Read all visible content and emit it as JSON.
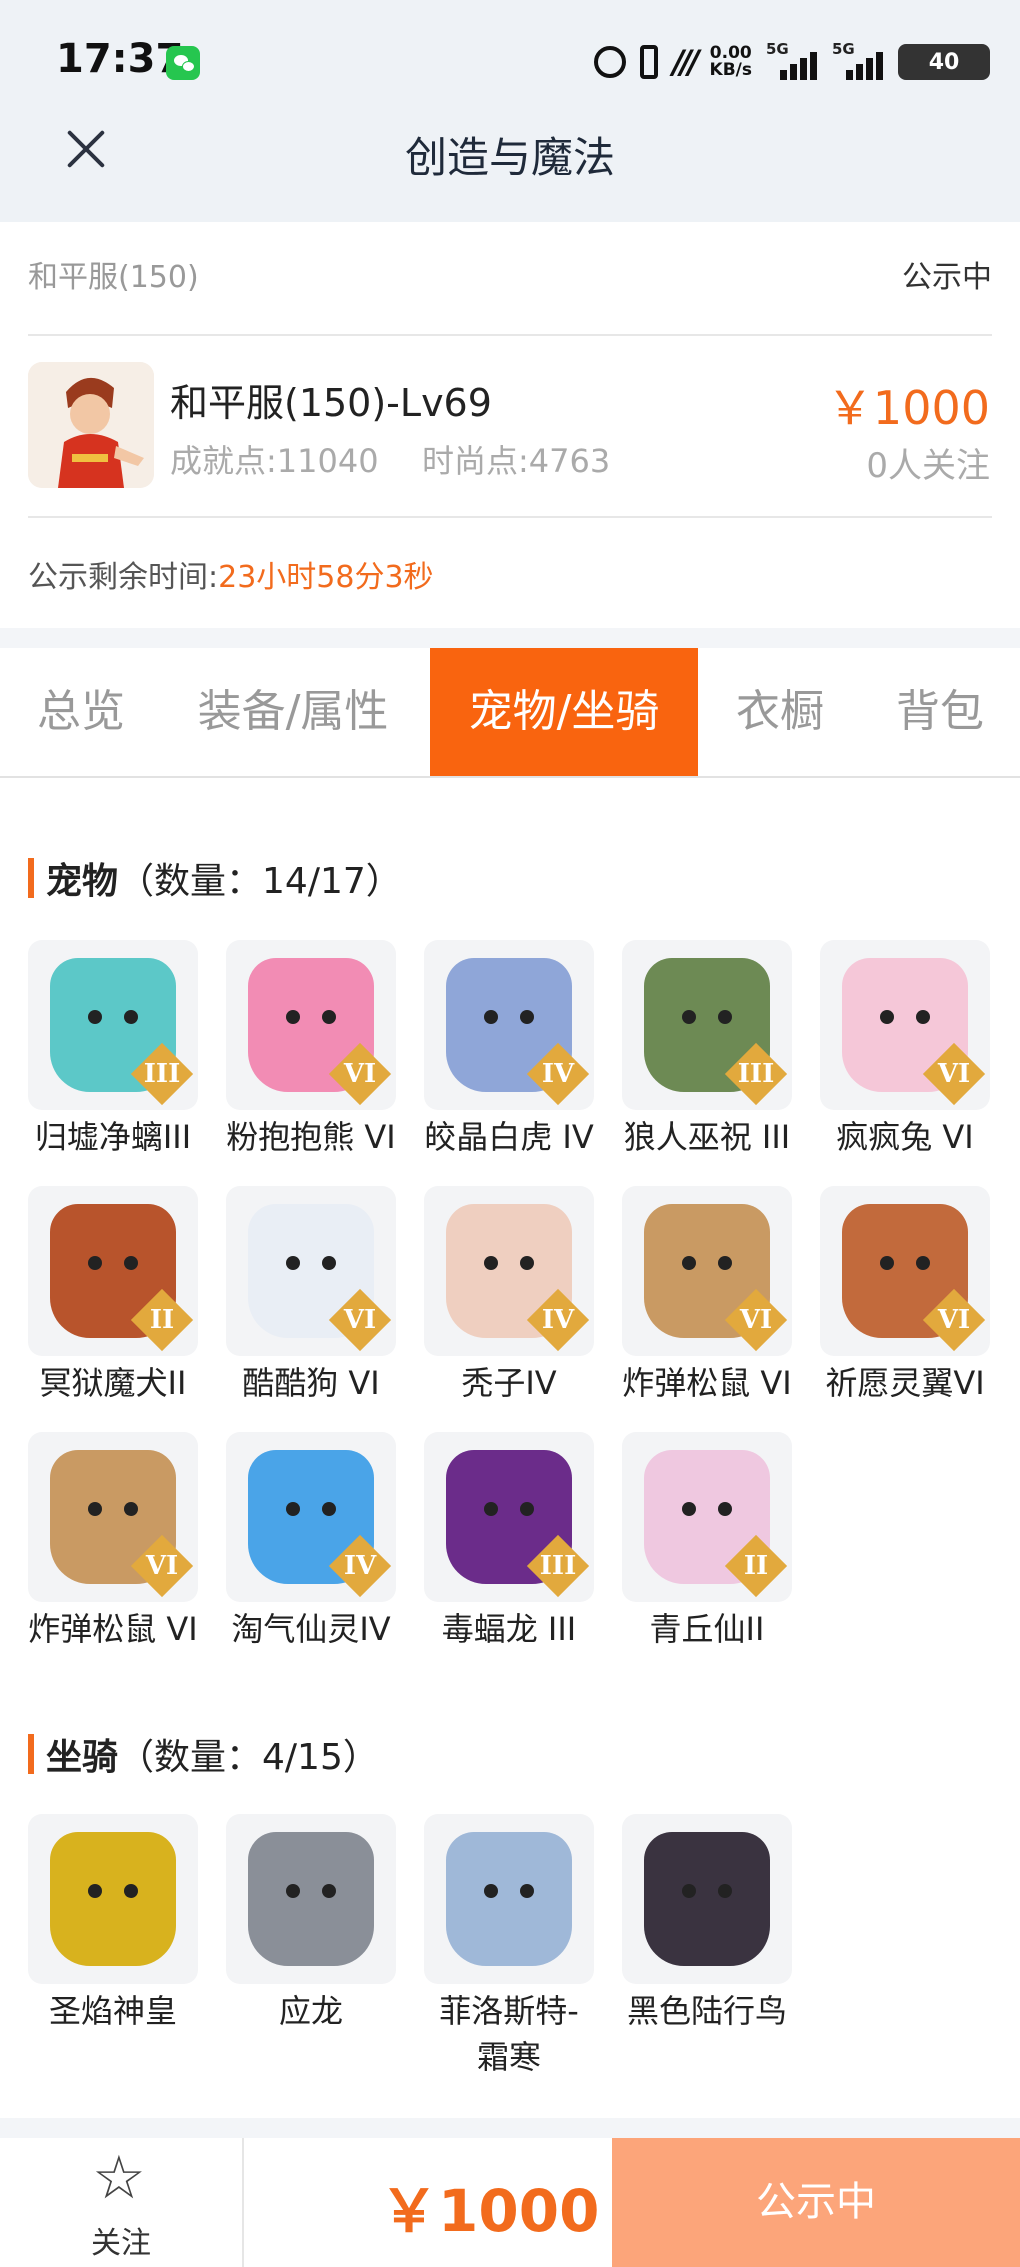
{
  "status_bar": {
    "time": "17:37",
    "speed": "0.00",
    "speed_unit": "KB/s",
    "net1": "5G",
    "net2": "5G",
    "battery": "40"
  },
  "header": {
    "title": "创造与魔法"
  },
  "listing": {
    "server": "和平服(150)",
    "status": "公示中",
    "role_name": "和平服(150)-Lv69",
    "achievement": "成就点:11040",
    "fashion": "时尚点:4763",
    "price": "￥1000",
    "followers": "0人关注",
    "remaining_label": "公示剩余时间:",
    "remaining_value": "23小时58分3秒"
  },
  "tabs": [
    {
      "label": "总览"
    },
    {
      "label": "装备/属性"
    },
    {
      "label": "宠物/坐骑",
      "active": true
    },
    {
      "label": "衣橱"
    },
    {
      "label": "背包"
    }
  ],
  "pets": {
    "title": "宠物",
    "count": "（数量：14/17）",
    "items": [
      {
        "name": "归墟净螭III",
        "badge": "III",
        "color": "#5cc8c8"
      },
      {
        "name": "粉抱抱熊 VI",
        "badge": "VI",
        "color": "#f28cb4"
      },
      {
        "name": "皎晶白虎 IV",
        "badge": "IV",
        "color": "#8fa6d8"
      },
      {
        "name": "狼人巫祝 III",
        "badge": "III",
        "color": "#6d8a54"
      },
      {
        "name": "疯疯兔 VI",
        "badge": "VI",
        "color": "#f5c7d8"
      },
      {
        "name": "冥狱魔犬II",
        "badge": "II",
        "color": "#b8542c"
      },
      {
        "name": "酷酷狗 VI",
        "badge": "VI",
        "color": "#e9eef5"
      },
      {
        "name": "秃子IV",
        "badge": "IV",
        "color": "#efcfc0"
      },
      {
        "name": "炸弹松鼠 VI",
        "badge": "VI",
        "color": "#c99a63"
      },
      {
        "name": "祈愿灵翼VI",
        "badge": "VI",
        "color": "#c26a3c"
      },
      {
        "name": "炸弹松鼠 VI",
        "badge": "VI",
        "color": "#c99a63"
      },
      {
        "name": "淘气仙灵IV",
        "badge": "IV",
        "color": "#4aa4e8"
      },
      {
        "name": "毒蝠龙 III",
        "badge": "III",
        "color": "#6b2c8a"
      },
      {
        "name": "青丘仙II",
        "badge": "II",
        "color": "#efc8e0"
      }
    ]
  },
  "mounts": {
    "title": "坐骑",
    "count": "（数量：4/15）",
    "items": [
      {
        "name": "圣焰神皇",
        "color": "#d8b21e"
      },
      {
        "name": "应龙",
        "color": "#8a8f98"
      },
      {
        "name": "菲洛斯特-霜寒",
        "line1": "菲洛斯特-",
        "line2": "霜寒",
        "color": "#9fb8d8"
      },
      {
        "name": "黑色陆行鸟",
        "color": "#3a3340"
      }
    ]
  },
  "bottom_bar": {
    "follow_label": "关注",
    "price": "￥1000",
    "status": "公示中"
  },
  "colors": {
    "accent": "#f9640f",
    "price": "#f26b1d",
    "status_button": "#fca57a"
  }
}
